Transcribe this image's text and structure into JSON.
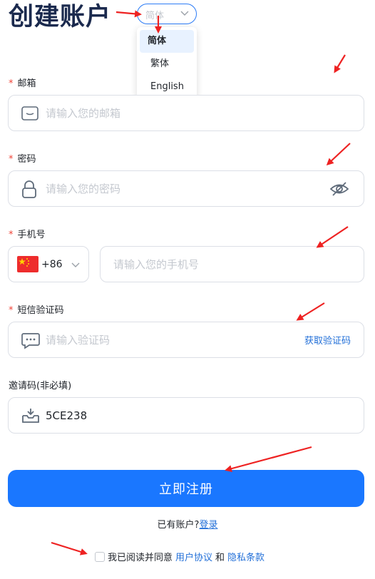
{
  "page_title": "创建账户",
  "language": {
    "current": "简体",
    "options": [
      "简体",
      "繁体",
      "English"
    ]
  },
  "email": {
    "label": "邮箱",
    "placeholder": "请输入您的邮箱",
    "icon": "mail-icon"
  },
  "password": {
    "label": "密码",
    "placeholder": "请输入您的密码",
    "icon": "lock-icon",
    "toggle_icon": "eye-off-icon"
  },
  "phone": {
    "label": "手机号",
    "country_code": "+86",
    "flag": "china-flag-icon",
    "placeholder": "请输入您的手机号"
  },
  "sms_code": {
    "label": "短信验证码",
    "placeholder": "请输入验证码",
    "icon": "chat-icon",
    "get_code": "获取验证码"
  },
  "invite": {
    "label": "邀请码(非必填)",
    "value": "5CE238",
    "icon": "inbox-icon"
  },
  "required_mark": "*",
  "register_button": "立即注册",
  "login": {
    "prompt": "已有账户?",
    "link": "登录"
  },
  "agreement": {
    "prefix": "我已阅读并同意",
    "terms": "用户协议",
    "and": "和",
    "privacy": "隐私条款"
  },
  "colors": {
    "primary": "#1a77ff",
    "link": "#2370d8",
    "title": "#1b2a4e",
    "required": "#f04438",
    "annotation_arrow": "#ee2222"
  }
}
